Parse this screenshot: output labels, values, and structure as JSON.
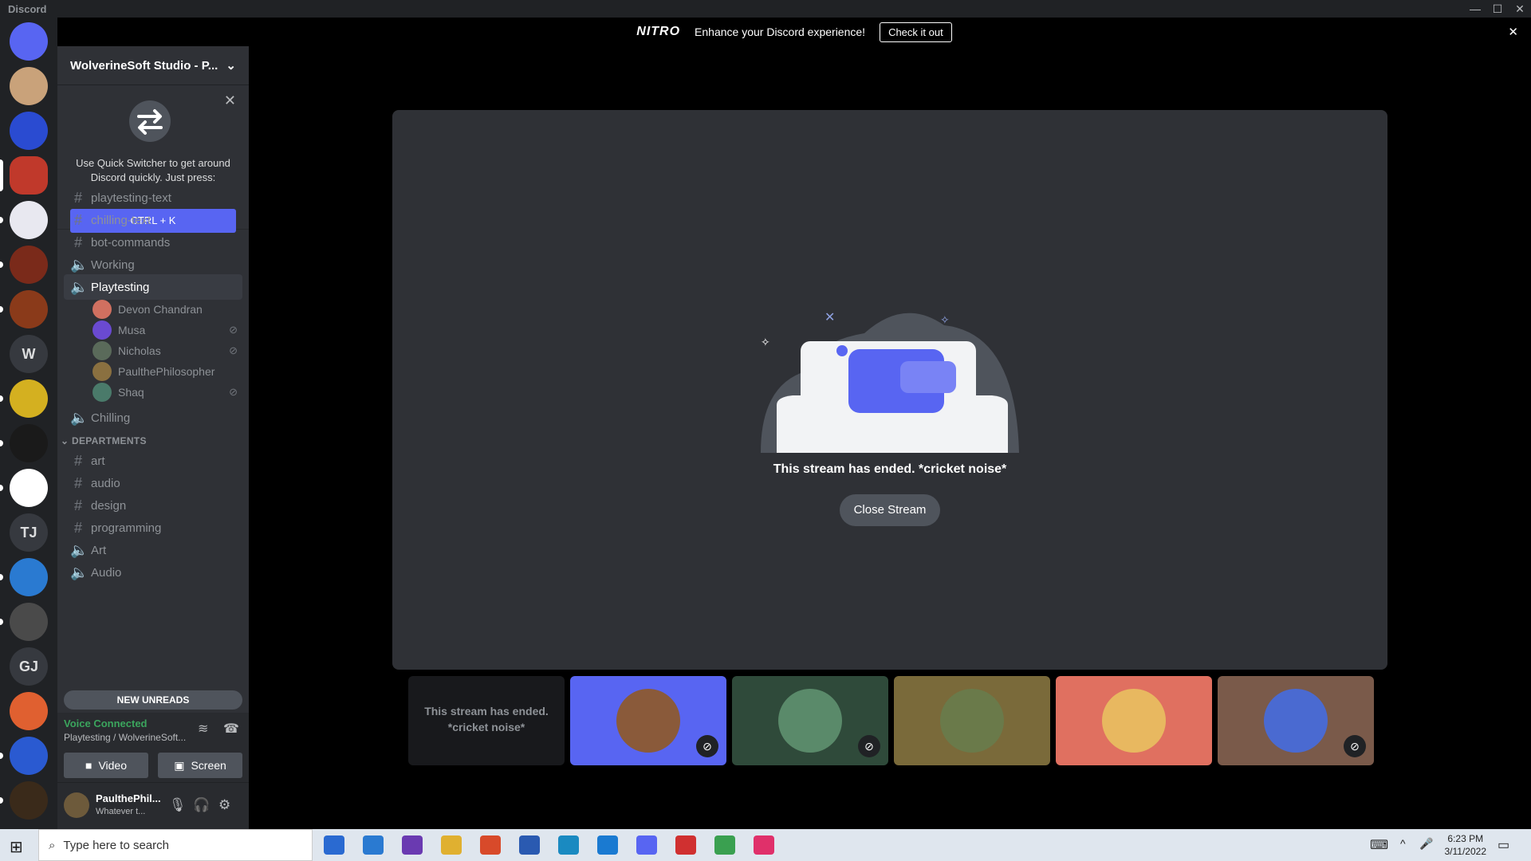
{
  "window": {
    "title": "Discord",
    "controls": [
      "—",
      "☐",
      "✕"
    ]
  },
  "nitro_bar": {
    "logo": "NITRO",
    "message": "Enhance your Discord experience!",
    "button": "Check it out",
    "close": "✕"
  },
  "servers": [
    {
      "label": "",
      "color": "#5865f2",
      "icon": "discord-home-icon"
    },
    {
      "label": "",
      "color": "#c9a27a"
    },
    {
      "label": "",
      "color": "#2a4bd1"
    },
    {
      "label": "",
      "color": "#c0392b",
      "active": true
    },
    {
      "label": "",
      "color": "#e8e8f0"
    },
    {
      "label": "",
      "color": "#7a2a1a"
    },
    {
      "label": "",
      "color": "#8a3a1a"
    },
    {
      "label": "W",
      "color": "#36393f"
    },
    {
      "label": "",
      "color": "#d4b020"
    },
    {
      "label": "",
      "color": "#1a1a1a"
    },
    {
      "label": "",
      "color": "#ffffff"
    },
    {
      "label": "TJ",
      "color": "#36393f"
    },
    {
      "label": "",
      "color": "#2a7ad1"
    },
    {
      "label": "",
      "color": "#4a4a4a"
    },
    {
      "label": "GJ",
      "color": "#36393f"
    },
    {
      "label": "",
      "color": "#e06030"
    },
    {
      "label": "",
      "color": "#2a5ad1"
    },
    {
      "label": "",
      "color": "#3a2a1a"
    }
  ],
  "guild": {
    "name": "WolverineSoft Studio - P...",
    "chevron": "⌄"
  },
  "quick_switcher": {
    "text": "Use Quick Switcher to get around Discord quickly. Just press:",
    "button": "CTRL + K",
    "close": "✕"
  },
  "channels": [
    {
      "type": "text",
      "name": "playtesting-text"
    },
    {
      "type": "text",
      "name": "chilling-text"
    },
    {
      "type": "text",
      "name": "bot-commands"
    },
    {
      "type": "voice",
      "name": "Working"
    },
    {
      "type": "voice",
      "name": "Playtesting",
      "active": true
    }
  ],
  "voice_users": [
    {
      "name": "Devon Chandran",
      "muted": false,
      "color": "#d07060"
    },
    {
      "name": "Musa",
      "muted": true,
      "color": "#6a4ad1"
    },
    {
      "name": "Nicholas",
      "muted": true,
      "color": "#5a6a5a"
    },
    {
      "name": "PaulthePhilosopher",
      "muted": false,
      "color": "#8a7040"
    },
    {
      "name": "Shaq",
      "muted": true,
      "color": "#4a7a6a"
    }
  ],
  "channels_after": [
    {
      "type": "voice",
      "name": "Chilling"
    }
  ],
  "category": {
    "name": "DEPARTMENTS",
    "channels": [
      {
        "type": "text",
        "name": "art"
      },
      {
        "type": "text",
        "name": "audio"
      },
      {
        "type": "text",
        "name": "design"
      },
      {
        "type": "text",
        "name": "programming"
      },
      {
        "type": "voice",
        "name": "Art"
      },
      {
        "type": "voice",
        "name": "Audio"
      }
    ]
  },
  "new_unreads": "NEW UNREADS",
  "voice_panel": {
    "status": "Voice Connected",
    "location": "Playtesting / WolverineSoft...",
    "video": "Video",
    "screen": "Screen"
  },
  "user": {
    "name": "PaulthePhil...",
    "status": "Whatever t..."
  },
  "stream": {
    "ended_text": "This stream has ended. *cricket noise*",
    "close_button": "Close Stream"
  },
  "tiles": [
    {
      "type": "text",
      "text": "This stream has ended. *cricket noise*",
      "bg": "#18191c"
    },
    {
      "type": "avatar",
      "bg": "#5865f2",
      "muted": true,
      "pic": "#8a5a3a"
    },
    {
      "type": "avatar",
      "bg": "#2f4a3a",
      "muted": true,
      "pic": "#5a8a6a"
    },
    {
      "type": "avatar",
      "bg": "#7a6a3a",
      "muted": false,
      "pic": "#6a7a4a"
    },
    {
      "type": "avatar",
      "bg": "#e07060",
      "muted": false,
      "pic": "#e8b860"
    },
    {
      "type": "avatar",
      "bg": "#7a5a4a",
      "muted": true,
      "pic": "#4a6ad1"
    }
  ],
  "taskbar": {
    "search_placeholder": "Type here to search",
    "time": "6:23 PM",
    "date": "3/11/2022",
    "apps": [
      {
        "name": "store",
        "color": "#2a6ad1"
      },
      {
        "name": "mail",
        "color": "#2a7ad1"
      },
      {
        "name": "github",
        "color": "#6a3ab1"
      },
      {
        "name": "explorer",
        "color": "#e0b030"
      },
      {
        "name": "office",
        "color": "#d84a2a"
      },
      {
        "name": "word",
        "color": "#2a5ab1"
      },
      {
        "name": "edge",
        "color": "#1a8ac1"
      },
      {
        "name": "vscode",
        "color": "#1a7ad1"
      },
      {
        "name": "discord",
        "color": "#5865f2"
      },
      {
        "name": "unity-red",
        "color": "#d03030"
      },
      {
        "name": "chrome",
        "color": "#3aa050"
      },
      {
        "name": "slack",
        "color": "#e0306a"
      }
    ]
  }
}
